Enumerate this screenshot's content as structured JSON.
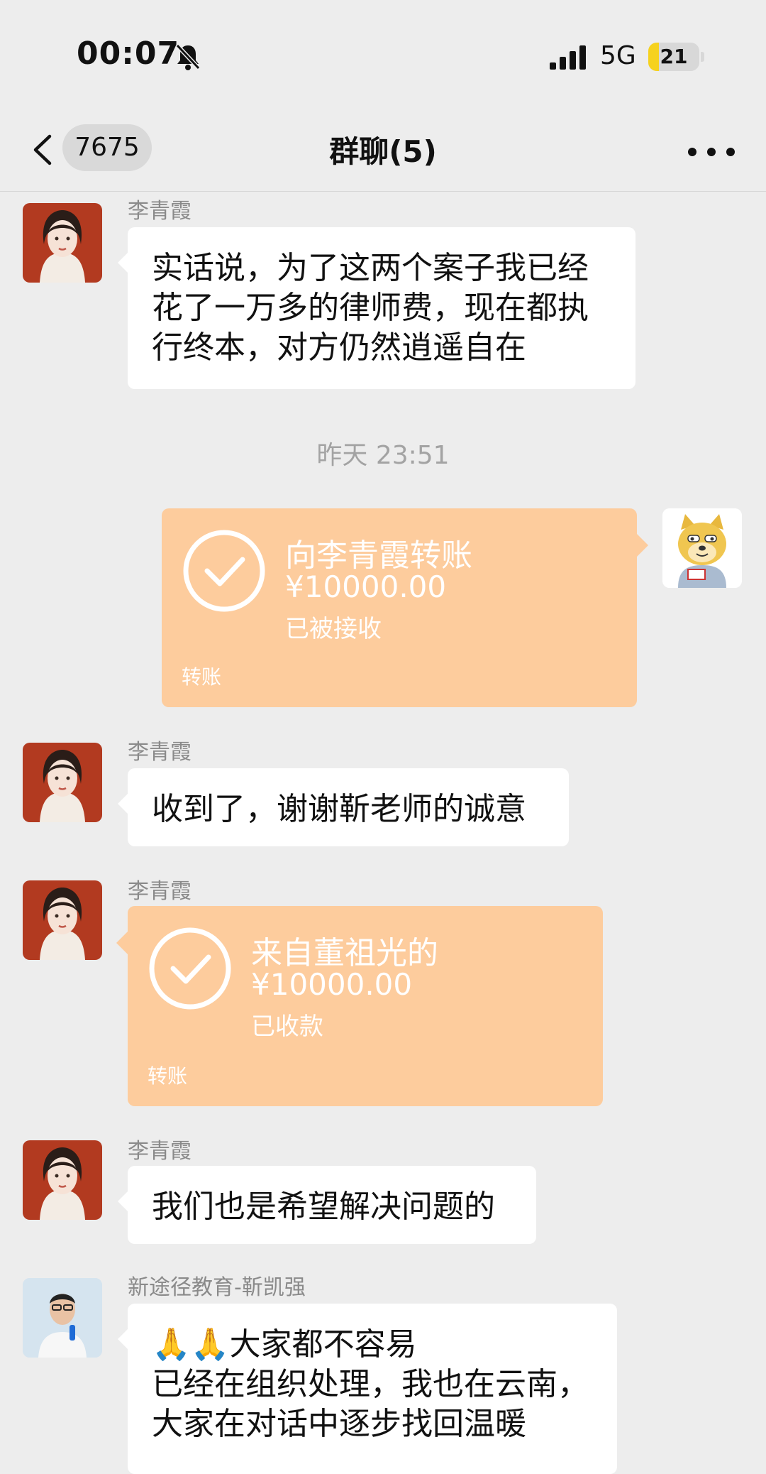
{
  "status_bar": {
    "time": "00:07",
    "network": "5G",
    "battery_level": "21",
    "battery_fraction": 0.21,
    "icons": [
      "bell-muted-icon",
      "signal-icon",
      "battery-icon"
    ]
  },
  "nav": {
    "back_badge": "7675",
    "title": "群聊(5)",
    "icons": [
      "chevron-left-icon",
      "more-icon"
    ]
  },
  "messages": {
    "m1": {
      "sender": "李青霞",
      "lines": [
        "实话说，为了这两个案子我已经",
        "花了一万多的律师费，现在都执",
        "行终本，对方仍然逍遥自在"
      ]
    },
    "time_divider": "昨天 23:51",
    "m2": {
      "title": "向李青霞转账",
      "amount": "¥10000.00",
      "status": "已被接收",
      "label": "转账"
    },
    "m3": {
      "sender": "李青霞",
      "text": "收到了，谢谢靳老师的诚意"
    },
    "m4": {
      "sender": "李青霞",
      "title": "来自董祖光的",
      "amount": "¥10000.00",
      "status": "已收款",
      "label": "转账"
    },
    "m5": {
      "sender": "李青霞",
      "text": "我们也是希望解决问题的"
    },
    "m6": {
      "sender": "新途径教育-靳凯强",
      "lines": [
        "🙏🙏大家都不容易",
        "已经在组织处理，我也在云南，",
        "大家在对话中逐步找回温暖"
      ]
    }
  },
  "colors": {
    "background": "#ededed",
    "bubble": "#ffffff",
    "transfer_card": "#fdcc9d",
    "battery_accent": "#f6d21e"
  }
}
